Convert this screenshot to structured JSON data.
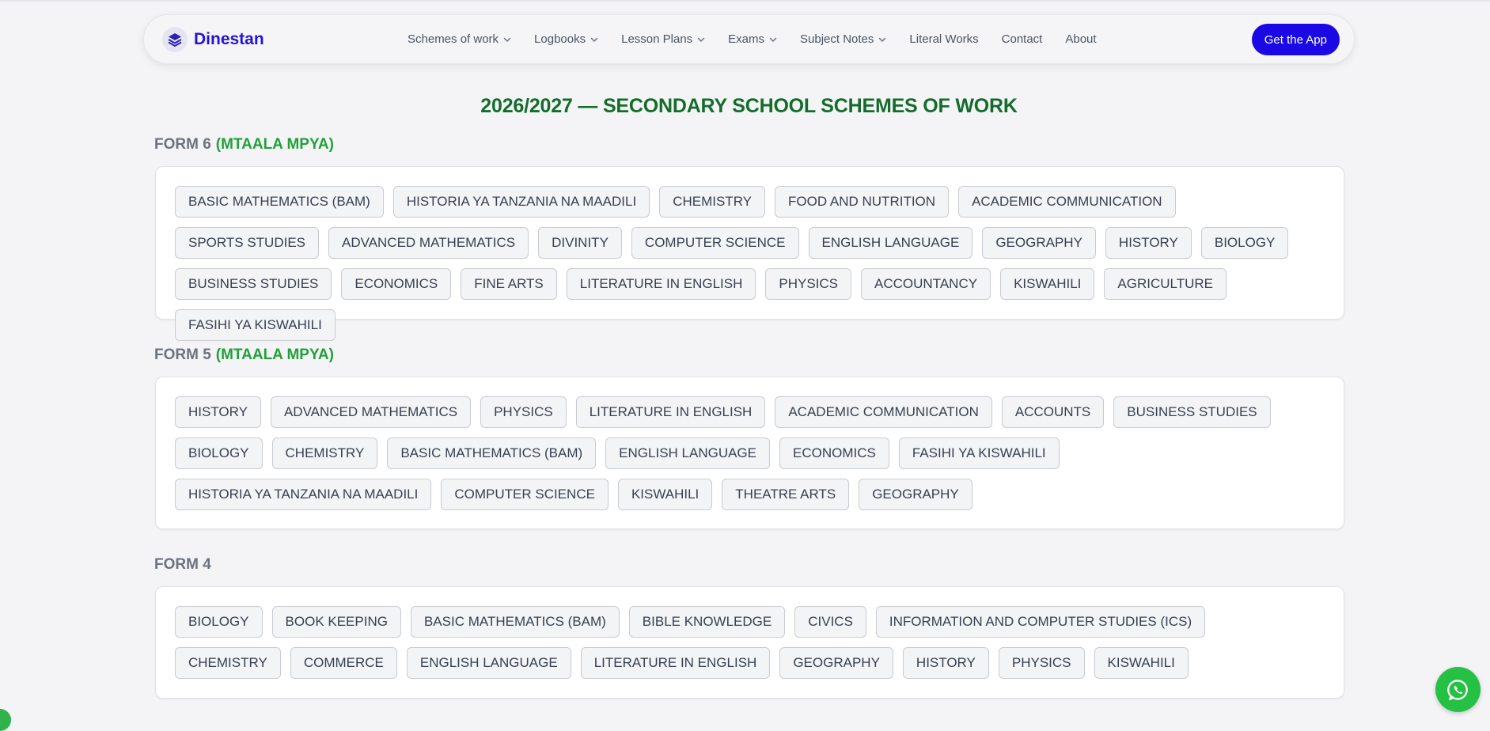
{
  "navbar": {
    "brand": "Dinestan",
    "links": [
      {
        "label": "Schemes of work",
        "dropdown": true
      },
      {
        "label": "Logbooks",
        "dropdown": true
      },
      {
        "label": "Lesson Plans",
        "dropdown": true
      },
      {
        "label": "Exams",
        "dropdown": true
      },
      {
        "label": "Subject Notes",
        "dropdown": true
      },
      {
        "label": "Literal Works",
        "dropdown": false
      },
      {
        "label": "Contact",
        "dropdown": false
      },
      {
        "label": "About",
        "dropdown": false
      }
    ],
    "cta": "Get the App"
  },
  "title": "2026/2027 — SECONDARY SCHOOL SCHEMES OF WORK",
  "sections": [
    {
      "heading": "FORM 6",
      "tag": "(MTAALA MPYA)",
      "subjects": [
        "BASIC MATHEMATICS (BAM)",
        "HISTORIA YA TANZANIA NA MAADILI",
        "CHEMISTRY",
        "FOOD AND NUTRITION",
        "ACADEMIC COMMUNICATION",
        "SPORTS STUDIES",
        "ADVANCED MATHEMATICS",
        "DIVINITY",
        "COMPUTER SCIENCE",
        "ENGLISH LANGUAGE",
        "GEOGRAPHY",
        "HISTORY",
        "BIOLOGY",
        "BUSINESS STUDIES",
        "ECONOMICS",
        "FINE ARTS",
        "LITERATURE IN ENGLISH",
        "PHYSICS",
        "ACCOUNTANCY",
        "KISWAHILI",
        "AGRICULTURE",
        "FASIHI YA KISWAHILI"
      ]
    },
    {
      "heading": "FORM 5",
      "tag": "(MTAALA MPYA)",
      "subjects": [
        "HISTORY",
        "ADVANCED MATHEMATICS",
        "PHYSICS",
        "LITERATURE IN ENGLISH",
        "ACADEMIC COMMUNICATION",
        "ACCOUNTS",
        "BUSINESS STUDIES",
        "BIOLOGY",
        "CHEMISTRY",
        "BASIC MATHEMATICS (BAM)",
        "ENGLISH LANGUAGE",
        "ECONOMICS",
        "FASIHI YA KISWAHILI",
        "HISTORIA YA TANZANIA NA MAADILI",
        "COMPUTER SCIENCE",
        "KISWAHILI",
        "THEATRE ARTS",
        "GEOGRAPHY"
      ]
    },
    {
      "heading": "FORM 4",
      "tag": "",
      "subjects": [
        "BIOLOGY",
        "BOOK KEEPING",
        "BASIC MATHEMATICS (BAM)",
        "BIBLE KNOWLEDGE",
        "CIVICS",
        "INFORMATION AND COMPUTER STUDIES (ICS)",
        "CHEMISTRY",
        "COMMERCE",
        "ENGLISH LANGUAGE",
        "LITERATURE IN ENGLISH",
        "GEOGRAPHY",
        "HISTORY",
        "PHYSICS",
        "KISWAHILI"
      ]
    }
  ],
  "icons": {
    "brand": "layers-logo-icon",
    "chevron": "chevron-down-icon",
    "whatsapp": "whatsapp-icon"
  },
  "colors": {
    "brand": "#2314d8",
    "cta": "#1a09e5",
    "title": "#146c2b",
    "tag": "#22a03a",
    "whatsapp": "#25c144"
  }
}
